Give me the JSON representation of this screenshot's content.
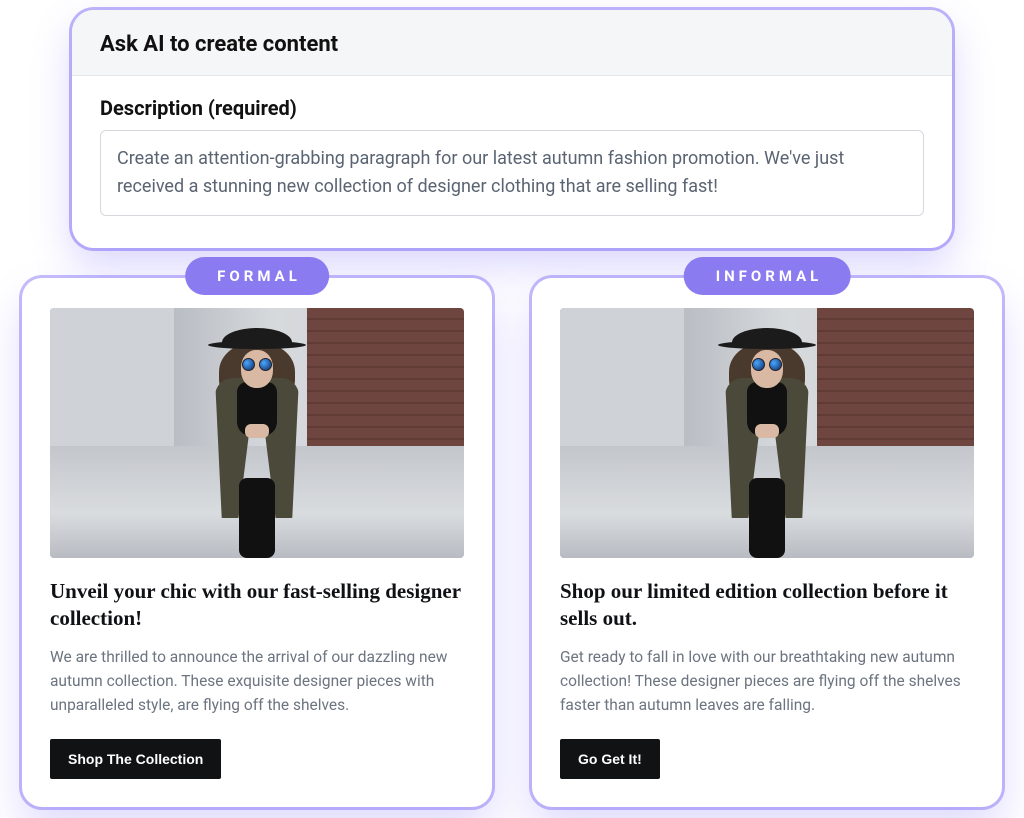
{
  "top": {
    "title": "Ask AI to create content",
    "field_label": "Description (required)",
    "description_value": "Create an attention-grabbing paragraph for our latest autumn fashion promotion. We've just received a stunning new collection of designer clothing that are selling fast!"
  },
  "cards": [
    {
      "tone_label": "FORMAL",
      "headline": "Unveil your chic with our fast-selling designer collection!",
      "body": "We are thrilled to announce the arrival of our dazzling new autumn collection. These exquisite designer pieces with unparalleled style, are flying off the shelves.",
      "cta": "Shop The Collection"
    },
    {
      "tone_label": "INFORMAL",
      "headline": "Shop our limited edition collection before it sells out.",
      "body": "Get ready to fall in love with our breathtaking new autumn collection! These designer pieces are flying off the shelves faster than autumn leaves are falling.",
      "cta": "Go Get It!"
    }
  ],
  "colors": {
    "accent": "#8a7cf0",
    "glow": "rgba(111,90,246,0.4)",
    "cta_bg": "#111214"
  }
}
